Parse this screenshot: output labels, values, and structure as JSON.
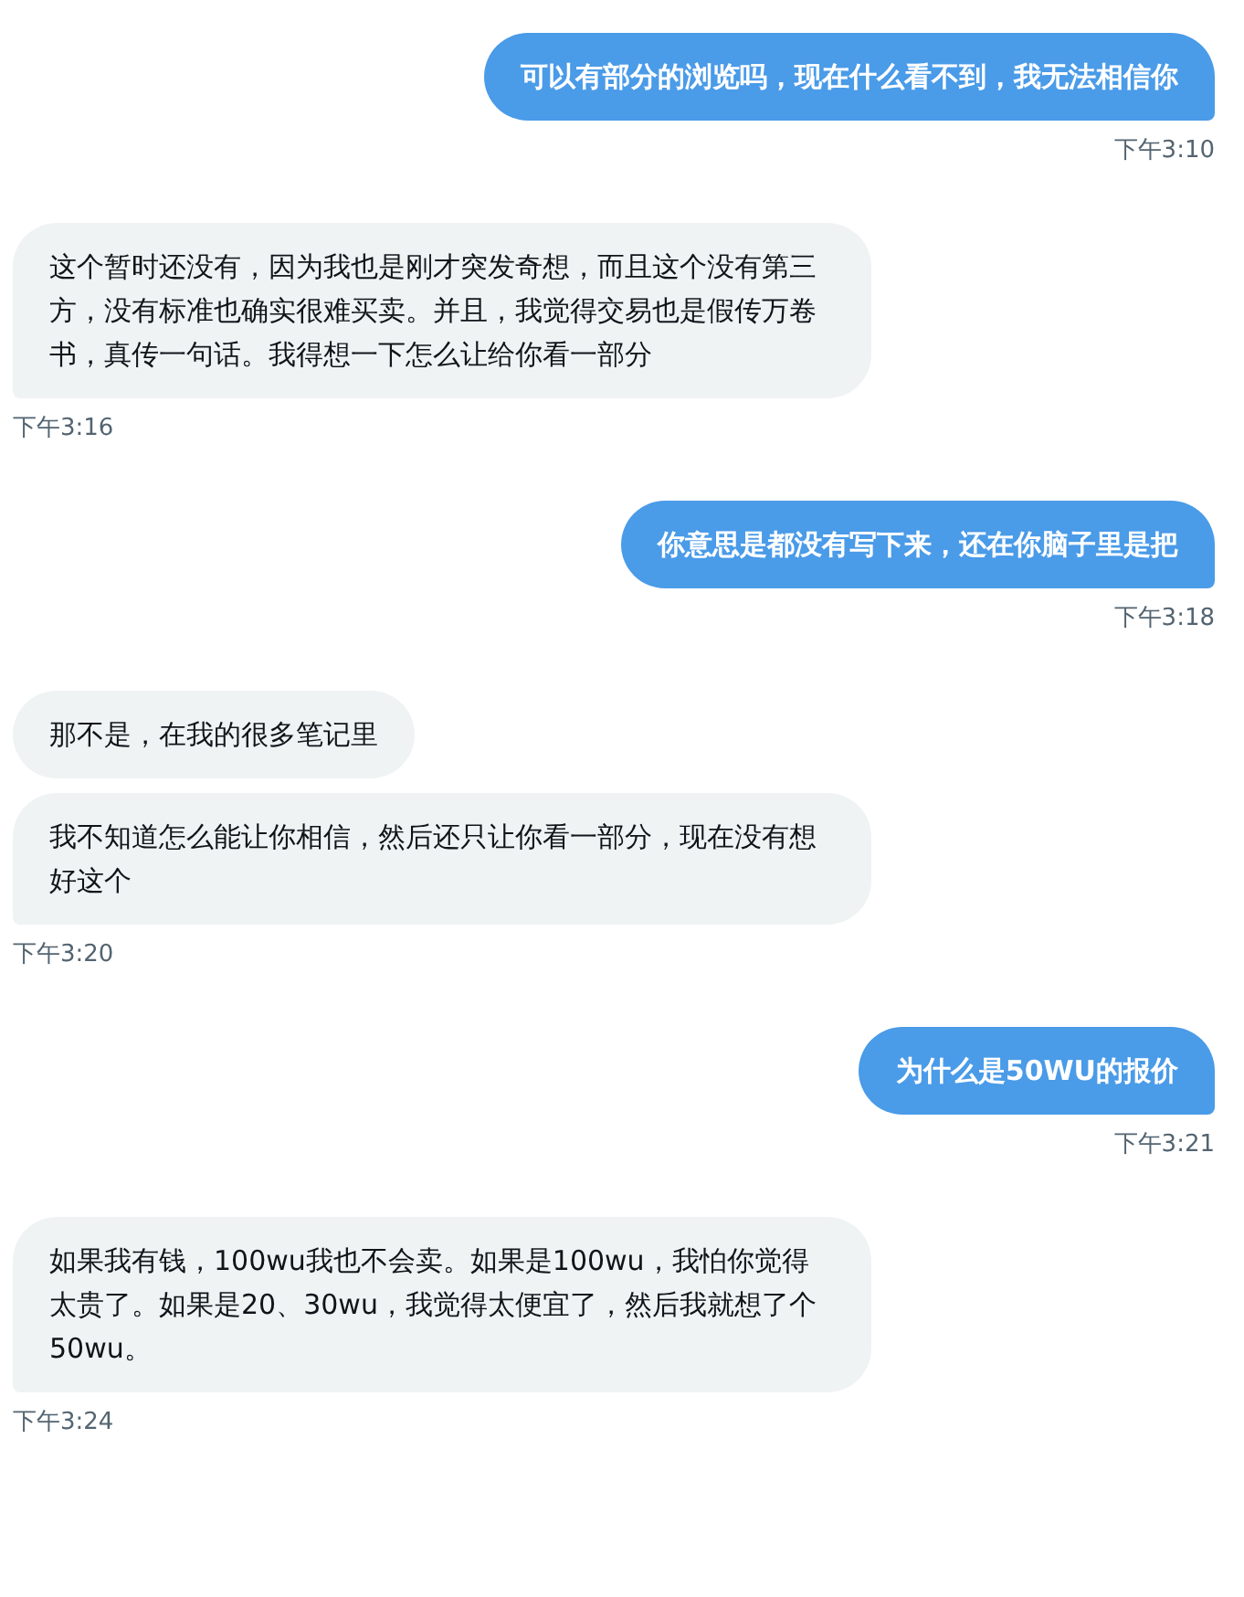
{
  "messages": [
    {
      "kind": "sent",
      "bubbles": [
        "可以有部分的浏览吗，现在什么看不到，我无法相信你"
      ],
      "time": "下午3:10"
    },
    {
      "kind": "received",
      "bubbles": [
        "这个暂时还没有，因为我也是刚才突发奇想，而且这个没有第三方，没有标准也确实很难买卖。并且，我觉得交易也是假传万卷书，真传一句话。我得想一下怎么让给你看一部分"
      ],
      "time": "下午3:16"
    },
    {
      "kind": "sent",
      "bubbles": [
        "你意思是都没有写下来，还在你脑子里是把"
      ],
      "time": "下午3:18"
    },
    {
      "kind": "received",
      "bubbles": [
        "那不是，在我的很多笔记里",
        "我不知道怎么能让你相信，然后还只让你看一部分，现在没有想好这个"
      ],
      "time": "下午3:20"
    },
    {
      "kind": "sent",
      "bubbles": [
        "为什么是50WU的报价"
      ],
      "time": "下午3:21"
    },
    {
      "kind": "received",
      "bubbles": [
        "如果我有钱，100wu我也不会卖。如果是100wu，我怕你觉得太贵了。如果是20、30wu，我觉得太便宜了，然后我就想了个50wu。"
      ],
      "time": "下午3:24"
    }
  ]
}
